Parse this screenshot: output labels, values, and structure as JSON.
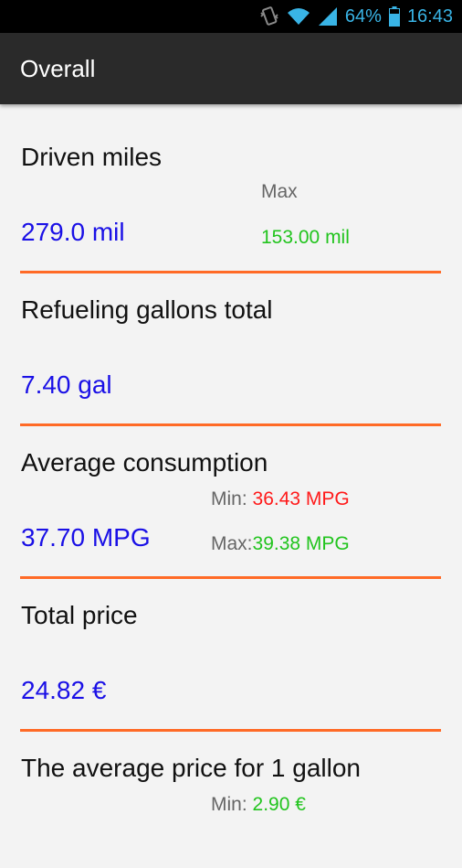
{
  "status_bar": {
    "battery": "64%",
    "time": "16:43",
    "icons": [
      "vibrate-icon",
      "wifi-icon",
      "signal-icon",
      "battery-icon"
    ]
  },
  "action_bar": {
    "title": "Overall"
  },
  "sections": {
    "driven": {
      "heading": "Driven miles",
      "value": "279.0 mil",
      "max_label": "Max",
      "max_value": "153.00 mil"
    },
    "gallons": {
      "heading": "Refueling gallons total",
      "value": "7.40 gal"
    },
    "consumption": {
      "heading": "Average consumption",
      "value": "37.70 MPG",
      "min_label": "Min: ",
      "min_value": "36.43 MPG",
      "max_label": "Max:",
      "max_value": "39.38 MPG"
    },
    "price": {
      "heading": "Total price",
      "value": "24.82 €"
    },
    "avg_price": {
      "heading": "The average price for 1 gallon",
      "min_label": "Min: ",
      "min_value": "2.90 €"
    }
  },
  "colors": {
    "value_blue": "#1a10e6",
    "max_green": "#22c41e",
    "min_red": "#ff1a1a",
    "divider_orange": "#ff6a26"
  }
}
